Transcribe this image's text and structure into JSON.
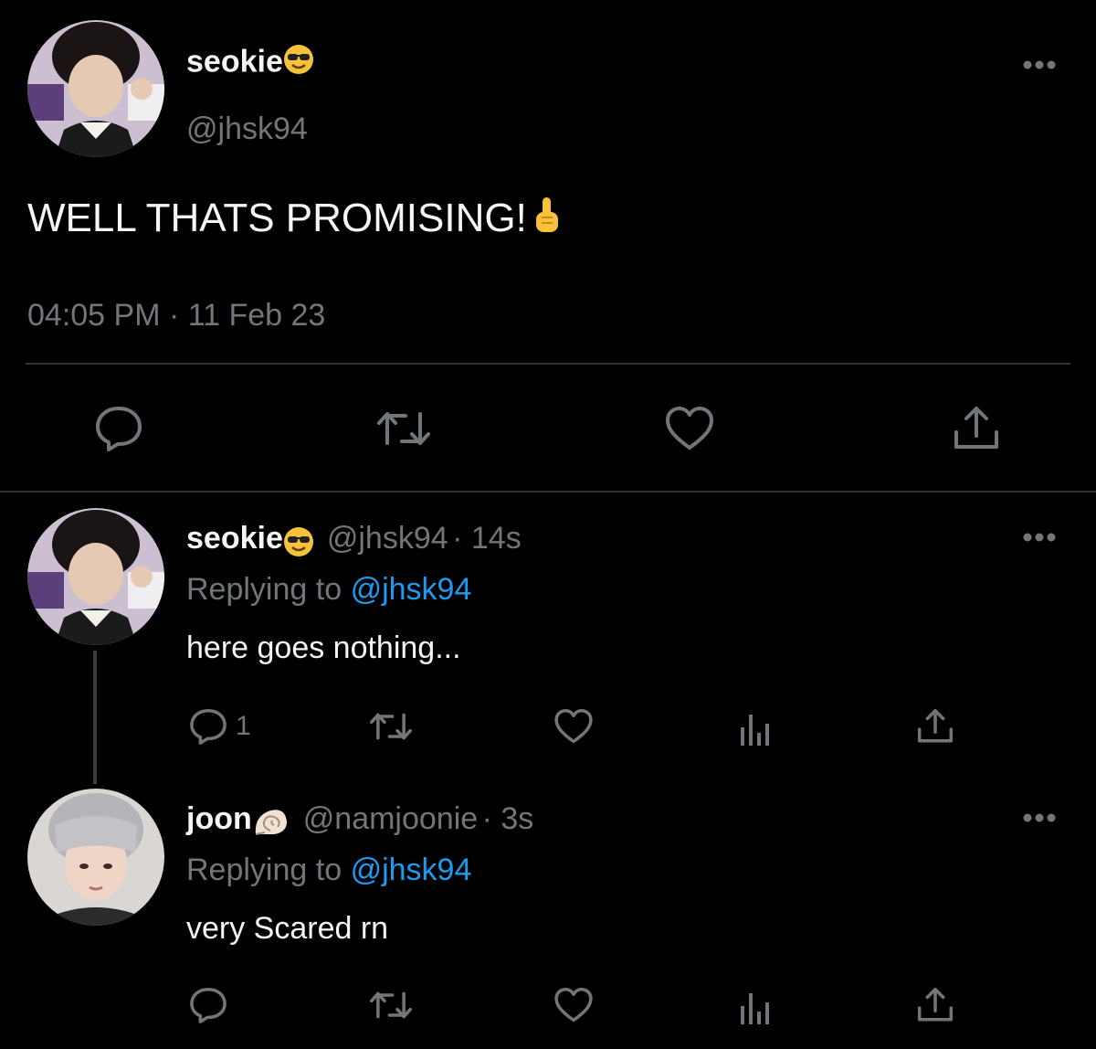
{
  "main_tweet": {
    "display_name": "seokie",
    "name_emoji": "smiling-face-with-sunglasses",
    "handle": "@jhsk94",
    "text": "WELL THATS PROMISING!",
    "text_emoji": "index-pointing-up",
    "timestamp": "04:05 PM · 11 Feb 23",
    "actions": [
      "reply-icon",
      "retweet-icon",
      "like-icon",
      "share-icon"
    ]
  },
  "replies": [
    {
      "display_name": "seokie",
      "name_emoji": "smiling-face-with-sunglasses",
      "handle": "@jhsk94",
      "time": "· 14s",
      "replying_to_label": "Replying to",
      "replying_to_handle": "@jhsk94",
      "text": "here goes nothing...",
      "reply_count": "1"
    },
    {
      "display_name": "joon",
      "name_emoji": "spiral-shell",
      "handle": "@namjoonie",
      "time": "· 3s",
      "replying_to_label": "Replying to",
      "replying_to_handle": "@jhsk94",
      "text": "very Scared rn",
      "reply_count": ""
    }
  ],
  "colors": {
    "background": "#000000",
    "text_primary": "#f5f5f5",
    "text_secondary": "#71767b",
    "link": "#1d9bf0",
    "divider": "#2f3336"
  }
}
